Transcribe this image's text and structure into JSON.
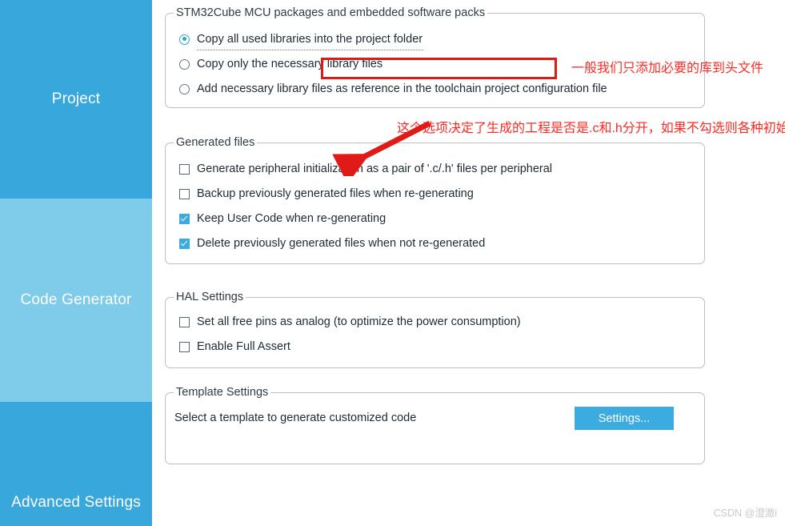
{
  "sidebar": {
    "items": [
      {
        "label": "Project",
        "selected": false
      },
      {
        "label": "Code Generator",
        "selected": true
      },
      {
        "label": "Advanced Settings",
        "selected": false
      }
    ]
  },
  "groups": {
    "packages": {
      "title": "STM32Cube MCU packages and embedded software packs",
      "options": [
        {
          "label": "Copy all used libraries into the project folder",
          "checked": true
        },
        {
          "label": "Copy only the necessary library files",
          "checked": false
        },
        {
          "label": "Add necessary library files as reference in the toolchain project configuration file",
          "checked": false
        }
      ]
    },
    "generated": {
      "title": "Generated files",
      "options": [
        {
          "label": "Generate peripheral initialization as a pair of '.c/.h' files per peripheral",
          "checked": false
        },
        {
          "label": "Backup previously generated files when re-generating",
          "checked": false
        },
        {
          "label": "Keep User Code when re-generating",
          "checked": true
        },
        {
          "label": "Delete previously generated files when not re-generated",
          "checked": true
        }
      ]
    },
    "hal": {
      "title": "HAL Settings",
      "options": [
        {
          "label": "Set all free pins as analog (to optimize the power consumption)",
          "checked": false
        },
        {
          "label": "Enable Full Assert",
          "checked": false
        }
      ]
    },
    "template": {
      "title": "Template Settings",
      "description": "Select a template to generate customized code",
      "button_label": "Settings..."
    }
  },
  "annotations": {
    "note_library": "一般我们只添加必要的库到头文件",
    "note_generated": "这个选项决定了生成的工程是否是.c和.h分开，如果不勾选则各种初始化都在main.c中"
  },
  "colors": {
    "accent": "#3cabe0",
    "sidebar_active": "#7ecbea",
    "sidebar_inactive": "#38a8dc",
    "annotation_red": "#ff2a23",
    "highlight_box": "#e01b17"
  },
  "watermark": "CSDN @澄澈i"
}
